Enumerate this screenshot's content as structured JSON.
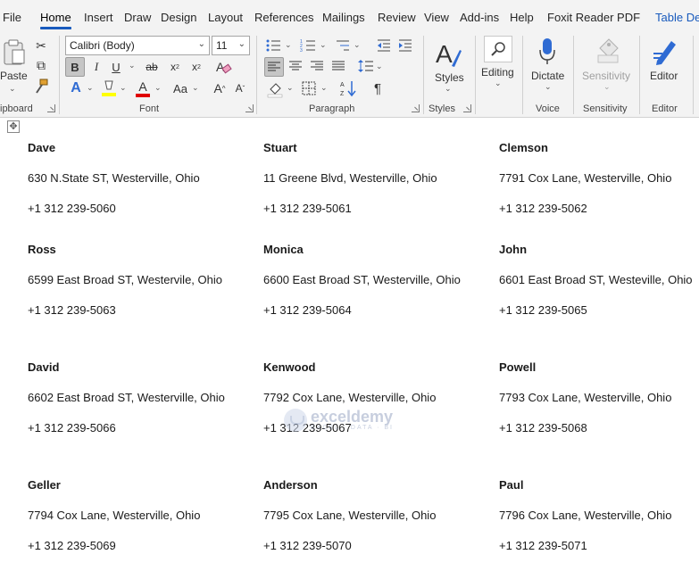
{
  "menu": {
    "tabs": [
      "File",
      "Home",
      "Insert",
      "Draw",
      "Design",
      "Layout",
      "References",
      "Mailings",
      "Review",
      "View",
      "Add-ins",
      "Help",
      "Foxit Reader PDF",
      "Table De"
    ],
    "active": "Home"
  },
  "ribbon": {
    "clipboard": {
      "paste_label": "Paste",
      "group_label": "ipboard"
    },
    "font": {
      "font_name": "Calibri (Body)",
      "font_size": "11",
      "group_label": "Font",
      "bold": "B",
      "italic": "I",
      "underline": "U",
      "strike": "ab",
      "subscript": "x",
      "subscript_mark": "2",
      "superscript": "x",
      "superscript_mark": "2",
      "change_case": "Aa",
      "grow": "A",
      "shrink": "A",
      "text_effects": "A",
      "font_color": "A"
    },
    "paragraph": {
      "group_label": "Paragraph"
    },
    "styles": {
      "label": "Styles",
      "group_label": "Styles"
    },
    "editing": {
      "label": "Editing"
    },
    "voice": {
      "dictate_label": "Dictate",
      "group_label": "Voice"
    },
    "sensitivity": {
      "label": "Sensitivity",
      "group_label": "Sensitivity"
    },
    "editor": {
      "label": "Editor",
      "group_label": "Editor"
    }
  },
  "colors": {
    "accent": "#185abd",
    "highlight": "#ffff00",
    "font_color": "#e00000",
    "effects": "#2f6bd3"
  },
  "labels": [
    {
      "name": "Dave",
      "address": "630 N.State ST, Westerville, Ohio",
      "phone": "+1 312 239-5060"
    },
    {
      "name": "Stuart",
      "address": "11 Greene Blvd, Westerville, Ohio",
      "phone": "+1 312 239-5061"
    },
    {
      "name": "Clemson",
      "address": "7791 Cox Lane, Westerville, Ohio",
      "phone": "+1 312 239-5062"
    },
    {
      "name": "Ross",
      "address": "6599 East Broad ST, Westervile, Ohio",
      "phone": "+1 312 239-5063"
    },
    {
      "name": "Monica",
      "address": "6600 East Broad ST, Westerville, Ohio",
      "phone": "+1 312 239-5064"
    },
    {
      "name": "John",
      "address": "6601 East Broad ST, Westeville, Ohio",
      "phone": "+1 312 239-5065"
    },
    {
      "name": "David",
      "address": "6602 East Broad ST, Westerville, Ohio",
      "phone": "+1 312 239-5066"
    },
    {
      "name": "Kenwood",
      "address": "7792 Cox Lane, Westerville, Ohio",
      "phone": "+1 312 239-5067"
    },
    {
      "name": "Powell",
      "address": "7793 Cox Lane, Westerville, Ohio",
      "phone": "+1 312 239-5068"
    },
    {
      "name": "Geller",
      "address": "7794 Cox Lane, Westerville, Ohio",
      "phone": "+1 312 239-5069"
    },
    {
      "name": "Anderson",
      "address": "7795 Cox Lane, Westerville, Ohio",
      "phone": "+1 312 239-5070"
    },
    {
      "name": "Paul",
      "address": "7796 Cox Lane, Westerville, Ohio",
      "phone": "+1 312 239-5071"
    }
  ],
  "watermark": {
    "brand": "exceldemy",
    "tagline": "EXCEL · DATA · BI"
  }
}
